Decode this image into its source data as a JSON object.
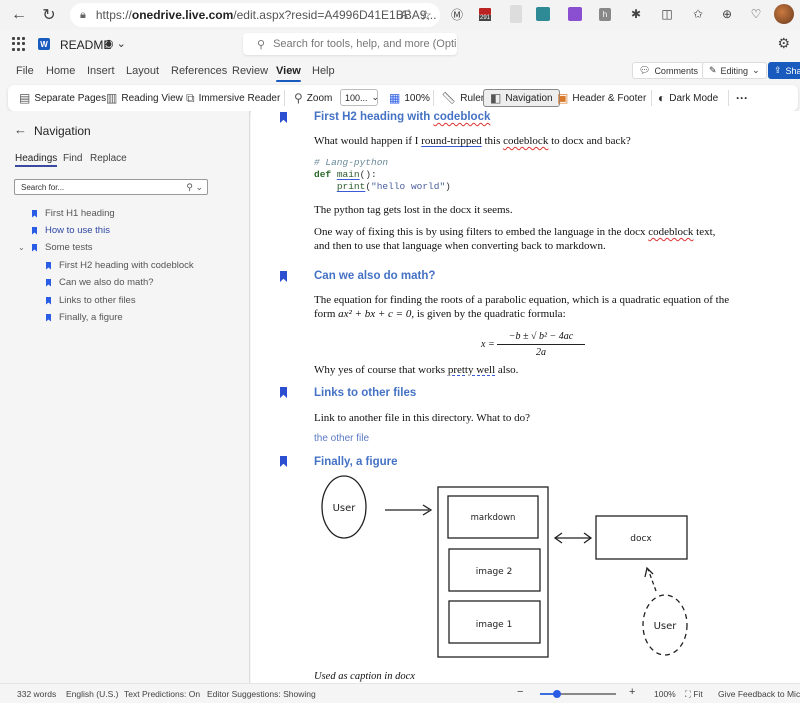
{
  "browser": {
    "url_prefix": "https://",
    "url_domain": "onedrive.live.com",
    "url_rest": "/edit.aspx?resid=A4996D41E1BBA9...",
    "read_aloud_label": "A",
    "extension_badge": "291"
  },
  "app": {
    "doc_name": "README",
    "search_placeholder": "Search for tools, help, and more (Option + Q)"
  },
  "menu": {
    "items": [
      "File",
      "Home",
      "Insert",
      "Layout",
      "References",
      "Review",
      "View",
      "Help"
    ],
    "active": "View",
    "comments_label": "Comments",
    "editing_label": "Editing",
    "share_label": "Share"
  },
  "ribbon": {
    "separate_pages": "Separate Pages",
    "reading_view": "Reading View",
    "immersive_reader": "Immersive Reader",
    "zoom": "Zoom",
    "zoom_value": "100...",
    "hundred_percent": "100%",
    "ruler": "Ruler",
    "navigation": "Navigation",
    "header_footer": "Header & Footer",
    "dark_mode": "Dark Mode",
    "more": "···"
  },
  "navpane": {
    "title": "Navigation",
    "tabs": [
      "Headings",
      "Find",
      "Replace"
    ],
    "active_tab": "Headings",
    "search_placeholder": "Search for...",
    "headings": [
      {
        "label": "First H1 heading",
        "level": 1
      },
      {
        "label": "How to use this",
        "level": 1,
        "current": true
      },
      {
        "label": "Some tests",
        "level": 1,
        "expanded": true
      },
      {
        "label": "First H2 heading with codeblock",
        "level": 2
      },
      {
        "label": "Can we also do math?",
        "level": 2
      },
      {
        "label": "Links to other files",
        "level": 2
      },
      {
        "label": "Finally, a figure",
        "level": 2
      }
    ]
  },
  "document": {
    "h_codeblock_a": "First H2 heading with ",
    "h_codeblock_b": "codeblock",
    "p1_a": "What would happen if I ",
    "p1_b": "round-tripped",
    "p1_c": " this ",
    "p1_d": "codeblock",
    "p1_e": " to docx and back?",
    "code_comment": "# Lang-python",
    "code_def": "def",
    "code_main": "main",
    "code_main_rest": "():",
    "code_indent": "    ",
    "code_print": "print",
    "code_paren_open": "(",
    "code_string": "\"hello world\"",
    "code_paren_close": ")",
    "p2": "The python tag gets lost in the docx it seems.",
    "p3_a": "One way of fixing this is by using filters to embed the language in the docx ",
    "p3_b": "codeblock",
    "p3_c": " text, and then to use that language when converting back to markdown.",
    "h_math": "Can we also do math?",
    "p4_a": "The equation for finding the roots of a parabolic equation, which is a quadratic equation of the form ",
    "p4_eq": "ax² + bx + c = 0",
    "p4_b": ", is given by the quadratic formula:",
    "formula_lhs": "x =",
    "formula_num": "−b ± √ b² − 4ac",
    "formula_den": "2a",
    "p5_a": "Why yes of course that works ",
    "p5_b": "pretty well",
    "p5_c": " also.",
    "h_links": "Links to other files",
    "p6": "Link to another file in this directory. What to do?",
    "link_other": "the other file",
    "h_figure": "Finally, a figure",
    "figure": {
      "user_left": "User",
      "markdown": "markdown",
      "image2": "image 2",
      "image1": "image 1",
      "docx": "docx",
      "user_right": "User"
    },
    "caption": "Used as caption in docx"
  },
  "statusbar": {
    "words": "332 words",
    "language": "English (U.S.)",
    "text_predictions": "Text Predictions: On",
    "editor_suggestions": "Editor Suggestions: Showing",
    "zoom_minus": "−",
    "zoom_plus": "+",
    "zoom_percent": "100%",
    "zoom_fraction": 0.22,
    "fit": "Fit",
    "feedback": "Give Feedback to Microsoft"
  }
}
